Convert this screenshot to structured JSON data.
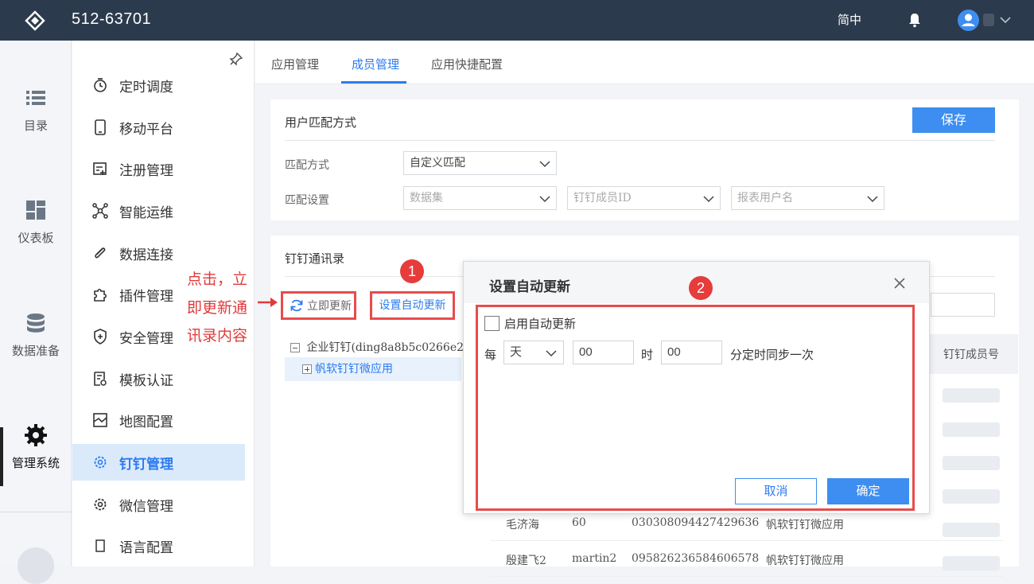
{
  "topbar": {
    "title": "512-63701",
    "lang": "简中"
  },
  "leftnav": {
    "items": [
      {
        "label": "目录",
        "icon": "list-icon"
      },
      {
        "label": "仪表板",
        "icon": "dashboard-icon"
      },
      {
        "label": "数据准备",
        "icon": "database-icon"
      },
      {
        "label": "管理系统",
        "icon": "gear-icon"
      }
    ]
  },
  "submenu": {
    "items": [
      {
        "label": "定时调度"
      },
      {
        "label": "移动平台"
      },
      {
        "label": "注册管理"
      },
      {
        "label": "智能运维"
      },
      {
        "label": "数据连接"
      },
      {
        "label": "插件管理"
      },
      {
        "label": "安全管理"
      },
      {
        "label": "模板认证"
      },
      {
        "label": "地图配置"
      },
      {
        "label": "钉钉管理"
      },
      {
        "label": "微信管理"
      },
      {
        "label": "语言配置"
      }
    ]
  },
  "tabs": [
    {
      "label": "应用管理"
    },
    {
      "label": "成员管理"
    },
    {
      "label": "应用快捷配置"
    }
  ],
  "match": {
    "heading": "用户匹配方式",
    "save": "保存",
    "method_label": "匹配方式",
    "method_value": "自定义匹配",
    "setting_label": "匹配设置",
    "dataset_ph": "数据集",
    "member_ph": "钉钉成员ID",
    "user_ph": "报表用户名"
  },
  "contacts": {
    "heading": "钉钉通讯录",
    "refresh": "立即更新",
    "auto": "设置自动更新",
    "tree_root": "企业钉钉(ding8a8b5c0266e2",
    "tree_child": "帆软钉钉微应用",
    "col_member": "钉钉成员号",
    "rows": [
      {
        "name": "毛济海",
        "id": "60",
        "phone": "030308094427429636",
        "app": "帆软钉钉微应用"
      },
      {
        "name": "殷建飞2",
        "id": "martin2",
        "phone": "095826236584606578",
        "app": "帆软钉钉微应用"
      }
    ]
  },
  "annotation": {
    "line1": "点击，立",
    "line2": "即更新通",
    "line3": "讯录内容",
    "badge1": "1",
    "badge2": "2"
  },
  "modal": {
    "title": "设置自动更新",
    "enable": "启用自动更新",
    "every": "每",
    "period": "天",
    "hour_value": "00",
    "hour_unit": "时",
    "minute_value": "00",
    "minute_suffix": "分定时同步一次",
    "cancel": "取消",
    "ok": "确定"
  },
  "colors": {
    "accent": "#3d8ef0",
    "topbar": "#2c3a4d",
    "annotation": "#e74c4c"
  }
}
